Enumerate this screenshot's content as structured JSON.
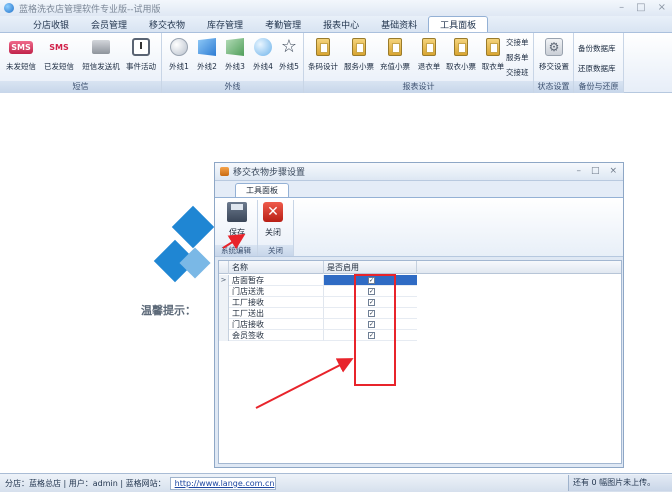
{
  "app": {
    "title": "蓝格洗衣店管理软件专业版--试用版"
  },
  "window_controls": {
    "minimize": "–",
    "maximize": "□",
    "close": "×"
  },
  "main_tabs": [
    "分店收银",
    "会员管理",
    "移交衣物",
    "库存管理",
    "考勤管理",
    "报表中心",
    "基础资料",
    "工具面板"
  ],
  "ribbon": {
    "sms_group": {
      "caption": "短信",
      "buttons": [
        "未发短信",
        "已发短信",
        "短信发送机",
        "事件活动"
      ]
    },
    "ext_group": {
      "caption": "外线",
      "buttons": [
        "外线1",
        "外线2",
        "外线3",
        "外线4",
        "外线5"
      ]
    },
    "report_group": {
      "caption": "报表设计",
      "buttons": [
        "条码设计",
        "服务小票",
        "充值小票",
        "退衣单",
        "取衣小票",
        "取衣单"
      ],
      "extra": [
        "交接单",
        "服务单",
        "交接班"
      ]
    },
    "step_group": {
      "caption": "状态设置",
      "buttons": [
        "移交设置"
      ]
    },
    "backup_group": {
      "caption": "备份与还原",
      "buttons": [
        "备份数据库",
        "还原数据库"
      ]
    }
  },
  "background_tip": "温馨提示：",
  "dialog": {
    "title": "移交衣物步骤设置",
    "tab": "工具面板",
    "save_label": "保存",
    "close_label": "关闭",
    "group_caption_1": "系统编辑",
    "group_caption_2": "关闭",
    "columns": [
      "名称",
      "是否启用"
    ],
    "rows": [
      {
        "name": "店面暂存",
        "enabled": true
      },
      {
        "name": "门店送洗",
        "enabled": true
      },
      {
        "name": "工厂接收",
        "enabled": true
      },
      {
        "name": "工厂送出",
        "enabled": true
      },
      {
        "name": "门店接收",
        "enabled": true
      },
      {
        "name": "会员签收",
        "enabled": true
      }
    ],
    "selected_row_marker": ">",
    "checkmark": "✓"
  },
  "statusbar": {
    "left": "分店：蓝格总店 | 用户：admin | 蓝格网站：",
    "url": "http://www.lange.com.cn",
    "right": "还有 0 幅图片未上传。"
  },
  "colors": {
    "accent": "#2f6bc4",
    "annotation": "#e8242b"
  }
}
